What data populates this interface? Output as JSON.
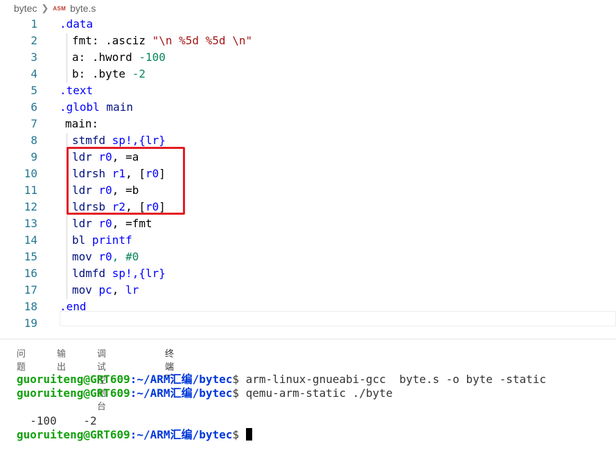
{
  "breadcrumb": {
    "folder": "bytec",
    "file_badge": "ASM",
    "file": "byte.s"
  },
  "editor": {
    "lines": [
      {
        "n": "1",
        "tokens": [
          {
            "t": ".data",
            "c": "kw"
          }
        ]
      },
      {
        "n": "2",
        "tokens": [
          {
            "t": "fmt: .asciz ",
            "c": "txt"
          },
          {
            "t": "\"\\n %5d %5d \\n\"",
            "c": "str"
          }
        ]
      },
      {
        "n": "3",
        "tokens": [
          {
            "t": "a: .hword ",
            "c": "txt"
          },
          {
            "t": "-100",
            "c": "num"
          }
        ]
      },
      {
        "n": "4",
        "tokens": [
          {
            "t": "b: .byte ",
            "c": "txt"
          },
          {
            "t": "-2",
            "c": "num"
          }
        ]
      },
      {
        "n": "5",
        "tokens": [
          {
            "t": ".text",
            "c": "kw"
          }
        ]
      },
      {
        "n": "6",
        "tokens": [
          {
            "t": ".globl",
            "c": "kw"
          },
          {
            "t": " main",
            "c": "reg"
          }
        ]
      },
      {
        "n": "7",
        "tokens": [
          {
            "t": "main:",
            "c": "txt"
          }
        ]
      },
      {
        "n": "8",
        "tokens": [
          {
            "t": "stmfd ",
            "c": "reg"
          },
          {
            "t": "sp!,{lr}",
            "c": "kw"
          }
        ]
      },
      {
        "n": "9",
        "tokens": [
          {
            "t": "ldr ",
            "c": "reg"
          },
          {
            "t": "r0",
            "c": "kw"
          },
          {
            "t": ", =a",
            "c": "txt"
          }
        ]
      },
      {
        "n": "10",
        "tokens": [
          {
            "t": "ldrsh ",
            "c": "reg"
          },
          {
            "t": "r1",
            "c": "kw"
          },
          {
            "t": ", [",
            "c": "txt"
          },
          {
            "t": "r0",
            "c": "kw"
          },
          {
            "t": "]",
            "c": "txt"
          }
        ]
      },
      {
        "n": "11",
        "tokens": [
          {
            "t": "ldr ",
            "c": "reg"
          },
          {
            "t": "r0",
            "c": "kw"
          },
          {
            "t": ", =b",
            "c": "txt"
          }
        ]
      },
      {
        "n": "12",
        "tokens": [
          {
            "t": "ldrsb ",
            "c": "reg"
          },
          {
            "t": "r2",
            "c": "kw"
          },
          {
            "t": ", [",
            "c": "txt"
          },
          {
            "t": "r0",
            "c": "kw"
          },
          {
            "t": "]",
            "c": "txt"
          }
        ]
      },
      {
        "n": "13",
        "tokens": [
          {
            "t": "ldr ",
            "c": "reg"
          },
          {
            "t": "r0",
            "c": "kw"
          },
          {
            "t": ", =fmt",
            "c": "txt"
          }
        ]
      },
      {
        "n": "14",
        "tokens": [
          {
            "t": "bl ",
            "c": "reg"
          },
          {
            "t": "printf",
            "c": "kw"
          }
        ]
      },
      {
        "n": "15",
        "tokens": [
          {
            "t": "mov ",
            "c": "reg"
          },
          {
            "t": "r0",
            "c": "kw"
          },
          {
            "t": ", #0",
            "c": "num"
          }
        ]
      },
      {
        "n": "16",
        "tokens": [
          {
            "t": "ldmfd ",
            "c": "reg"
          },
          {
            "t": "sp!,{lr}",
            "c": "kw"
          }
        ]
      },
      {
        "n": "17",
        "tokens": [
          {
            "t": "mov ",
            "c": "reg"
          },
          {
            "t": "pc",
            "c": "kw"
          },
          {
            "t": ", ",
            "c": "txt"
          },
          {
            "t": "lr",
            "c": "kw"
          }
        ]
      },
      {
        "n": "18",
        "tokens": [
          {
            "t": ".end",
            "c": "kw"
          }
        ]
      },
      {
        "n": "19",
        "tokens": []
      }
    ]
  },
  "panel": {
    "tabs": [
      "问题",
      "输出",
      "调试控制台",
      "终端"
    ],
    "active_tab": "终端"
  },
  "terminal": {
    "user_host": "guoruiteng@GRT609",
    "path": ":~/ARM汇编/bytec",
    "prompt_symbol": "$",
    "cmd1": " arm-linux-gnueabi-gcc  byte.s -o byte -static",
    "cmd2": " qemu-arm-static ./byte",
    "output": "  -100    -2",
    "cmd3": " "
  },
  "colors": {
    "highlight_box": "#e31b23",
    "line_number": "#237893",
    "keyword": "#0000ff",
    "string": "#a31515",
    "number": "#098658"
  }
}
